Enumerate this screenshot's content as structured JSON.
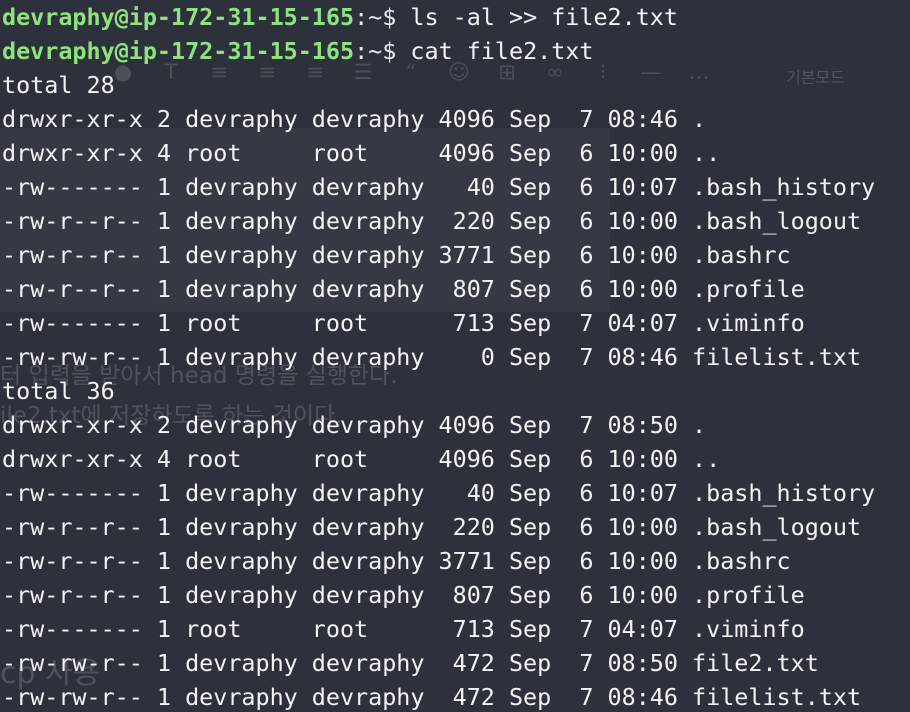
{
  "terminal": {
    "background": "#2d313c",
    "prompt_color": "#8fe37f",
    "text_color": "#f3f3f3"
  },
  "background_ghost": {
    "toolbar_icons": [
      "dot-icon",
      "text-icon",
      "align-left-icon",
      "align-center-icon",
      "align-right-icon",
      "list-icon",
      "quote-icon",
      "emoji-icon",
      "table-icon",
      "link-icon",
      "bullet-list-icon",
      "horizontal-rule-icon",
      "more-icon"
    ],
    "mode_label": "기본모드",
    "text_1": "터 입력을 받아서 head 명령을 실행한다.",
    "text_2": "ile2.txt에 저장하도록 하는 것이다.",
    "text_3": "cp 사용"
  },
  "session": [
    {
      "type": "prompt",
      "user": "devraphy@ip-172-31-15-165",
      "sep": ":",
      "path": "~$ ",
      "command": "ls -al >> file2.txt"
    },
    {
      "type": "prompt",
      "user": "devraphy@ip-172-31-15-165",
      "sep": ":",
      "path": "~$ ",
      "command": "cat file2.txt"
    },
    {
      "type": "output",
      "text": "total 28"
    },
    {
      "type": "output",
      "text": "drwxr-xr-x 2 devraphy devraphy 4096 Sep  7 08:46 ."
    },
    {
      "type": "output",
      "text": "drwxr-xr-x 4 root     root     4096 Sep  6 10:00 .."
    },
    {
      "type": "output",
      "text": "-rw------- 1 devraphy devraphy   40 Sep  6 10:07 .bash_history"
    },
    {
      "type": "output",
      "text": "-rw-r--r-- 1 devraphy devraphy  220 Sep  6 10:00 .bash_logout"
    },
    {
      "type": "output",
      "text": "-rw-r--r-- 1 devraphy devraphy 3771 Sep  6 10:00 .bashrc"
    },
    {
      "type": "output",
      "text": "-rw-r--r-- 1 devraphy devraphy  807 Sep  6 10:00 .profile"
    },
    {
      "type": "output",
      "text": "-rw------- 1 root     root      713 Sep  7 04:07 .viminfo"
    },
    {
      "type": "output",
      "text": "-rw-rw-r-- 1 devraphy devraphy    0 Sep  7 08:46 filelist.txt"
    },
    {
      "type": "output",
      "text": "total 36"
    },
    {
      "type": "output",
      "text": "drwxr-xr-x 2 devraphy devraphy 4096 Sep  7 08:50 ."
    },
    {
      "type": "output",
      "text": "drwxr-xr-x 4 root     root     4096 Sep  6 10:00 .."
    },
    {
      "type": "output",
      "text": "-rw------- 1 devraphy devraphy   40 Sep  6 10:07 .bash_history"
    },
    {
      "type": "output",
      "text": "-rw-r--r-- 1 devraphy devraphy  220 Sep  6 10:00 .bash_logout"
    },
    {
      "type": "output",
      "text": "-rw-r--r-- 1 devraphy devraphy 3771 Sep  6 10:00 .bashrc"
    },
    {
      "type": "output",
      "text": "-rw-r--r-- 1 devraphy devraphy  807 Sep  6 10:00 .profile"
    },
    {
      "type": "output",
      "text": "-rw------- 1 root     root      713 Sep  7 04:07 .viminfo"
    },
    {
      "type": "output",
      "text": "-rw-rw-r-- 1 devraphy devraphy  472 Sep  7 08:50 file2.txt"
    },
    {
      "type": "output",
      "text": "-rw-rw-r-- 1 devraphy devraphy  472 Sep  7 08:46 filelist.txt"
    }
  ]
}
